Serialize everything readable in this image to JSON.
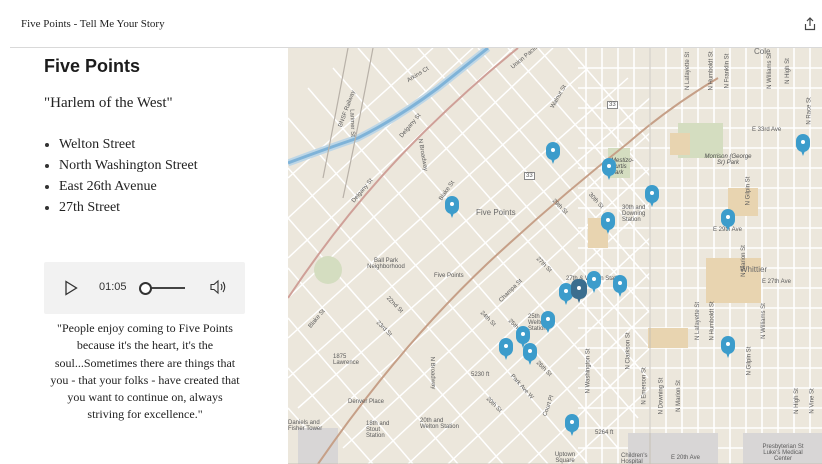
{
  "header": {
    "title": "Five Points - Tell Me Your Story"
  },
  "panel": {
    "heading": "Five Points",
    "subtitle": "\"Harlem of the West\"",
    "streets": [
      "Welton Street",
      "North Washington Street",
      "East 26th Avenue",
      "27th Street"
    ],
    "audio": {
      "time": "01:05",
      "progress_fraction": 0.0
    },
    "quote": "\"People enjoy coming to Five Points because it's the heart, it's the soul...Sometimes there are things that you - that your folks - have created that you want to continue on, always striving for excellence.\""
  },
  "map": {
    "labels": {
      "five_points": "Five Points",
      "five_points_station": "Five Points",
      "ball_park": "Ball Park Neighborhood",
      "whittier": "Whittier",
      "morrison_park": "Morrison (George Sr) Park",
      "mestizo_park": "Mestizo-Curtis Park",
      "denver_place": "Denver Place",
      "lawrence": "1875 Lawrence",
      "skyscraper": "Daniels and Fisher Tower",
      "uptown": "Uptown Square",
      "presbyterian": "Presbyterian St Luke's Medical Center",
      "childrens": "Children's Hospital",
      "station_30th": "30th and Downing Station",
      "station_25th": "25th & Welton Station",
      "station_20th": "20th and Welton Station",
      "station_18th": "18th and Stout Station",
      "station_27th": "27th & Welton Station",
      "e33rd": "E 33rd Ave",
      "e29th": "E 29th Ave",
      "e27th": "E 27th Ave",
      "e20th": "E 20th Ave",
      "cole": "Cole",
      "arkins": "Arkins Ct",
      "blake": "Blake St",
      "walnut": "Walnut St",
      "delgany": "Delgany St",
      "n_broadway": "N Broadway",
      "larimer": "Larimer St",
      "champa": "Champa St",
      "park_ave": "Park Ave W",
      "downing": "N Downing St",
      "marion": "N Marion St",
      "lafayette": "N Lafayette St",
      "humboldt": "N Humboldt St",
      "franklin": "N Franklin St",
      "williams": "N Williams St",
      "high": "N High St",
      "gilpin": "N Gilpin St",
      "race": "N Race St",
      "vine": "N Vine St",
      "emerson": "N Emerson St",
      "clarkson": "N Clarkson St",
      "n_washington": "N Washington St",
      "court_pl": "Court Pl",
      "st23rd": "23rd St",
      "st22nd": "22nd St",
      "st24th": "24th St",
      "st26th": "26th St",
      "st27th": "27th St",
      "st29th": "29th St",
      "st30th": "30th St",
      "st25th": "25th St",
      "st20th": "20th St",
      "union_pacific": "Union Pacific",
      "bnsf": "BNSF Railway",
      "elev1": "5230 ft",
      "elev2": "5264 ft",
      "route33a": "33",
      "route33b": "33"
    }
  }
}
